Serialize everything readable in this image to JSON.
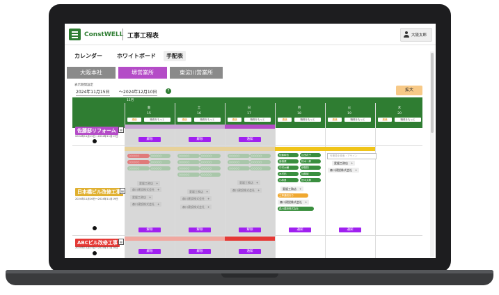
{
  "app": {
    "logo": "ConstWELL",
    "title": "工事工程表",
    "user": "大阪太郎"
  },
  "nav_tabs": [
    "カレンダー",
    "ホワイトボード",
    "手配表"
  ],
  "office_tabs": [
    "大阪本社",
    "堺営業所",
    "東淀川営業所"
  ],
  "period": {
    "label": "表示期間設定",
    "start": "2024年11月15日",
    "sep": "～",
    "end": "2024年12月10日",
    "help": "?"
  },
  "expand_label": "拡大",
  "calendar": {
    "month": "11月",
    "days": [
      {
        "dow": "金",
        "num": "15"
      },
      {
        "dow": "土",
        "num": "16"
      },
      {
        "dow": "日",
        "num": "17"
      },
      {
        "dow": "月",
        "num": "18"
      },
      {
        "dow": "火",
        "num": "19"
      },
      {
        "dow": "水",
        "num": "20"
      }
    ],
    "cell_tag": "連絡",
    "cell_note": "職長をもっと"
  },
  "projects": [
    {
      "name": "佐藤邸リフォーム",
      "color": "#b44cc7",
      "dates": "2024年11月15日〜2024年11月17日"
    },
    {
      "name": "日本橋ビル改修工事",
      "color": "#e0b030",
      "dates": "2024年11月16日〜2024年11月19日"
    },
    {
      "name": "ABCビル改修工事",
      "color": "#e53935",
      "dates": "2024年11月15日〜2024年11月20日"
    }
  ],
  "buttons": {
    "release": "解除",
    "notify": "通知",
    "add_company": "+"
  },
  "workers": {
    "faded": [
      "○○○○○",
      "○○○○○",
      "○○○○○",
      "○○○○○",
      "○○○○○",
      "○○○○○",
      "○○○○○",
      "○○○○○"
    ],
    "col4": [
      "佐藤和也",
      "山田花子",
      "高橋健",
      "鈴木一郎",
      "中村大輔",
      "伊藤翔",
      "木村拓",
      "加藤誠",
      "小林勇",
      "田中太郎"
    ],
    "search_placeholder": "作業員を検索・アサイン"
  },
  "companies": {
    "a": "愛媛工務店",
    "b": "森川建設株式会社",
    "c": "工事通知あり",
    "d": "愛媛工務店",
    "e": "森川建設株式会社"
  },
  "colors": {
    "brand": "#2e7d32",
    "accent": "#b44cc7",
    "notify": "#a020f0"
  }
}
